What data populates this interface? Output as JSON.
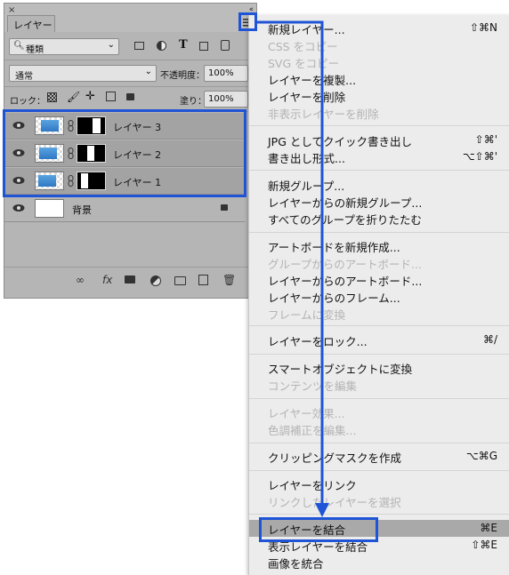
{
  "panel": {
    "close_glyph": "×",
    "collapse_glyph": "‹‹",
    "tab_label": "レイヤー",
    "filter_label": "種類",
    "blend_mode": "通常",
    "opacity_label": "不透明度：",
    "opacity_value": "100%",
    "lock_label": "ロック：",
    "fill_label": "塗り：",
    "fill_value": "100%",
    "layers": [
      {
        "name": "レイヤー 3"
      },
      {
        "name": "レイヤー 2"
      },
      {
        "name": "レイヤー 1"
      },
      {
        "name": "背景"
      }
    ],
    "fx_label": "fx"
  },
  "menu": {
    "items": [
      {
        "label": "新規レイヤー...",
        "shortcut": "⇧⌘N",
        "disabled": false
      },
      {
        "label": "CSS をコピー",
        "shortcut": "",
        "disabled": true
      },
      {
        "label": "SVG をコピー",
        "shortcut": "",
        "disabled": true
      },
      {
        "label": "レイヤーを複製...",
        "shortcut": "",
        "disabled": false
      },
      {
        "label": "レイヤーを削除",
        "shortcut": "",
        "disabled": false
      },
      {
        "label": "非表示レイヤーを削除",
        "shortcut": "",
        "disabled": true
      },
      {
        "label": "JPG としてクイック書き出し",
        "shortcut": "⇧⌘'",
        "disabled": false
      },
      {
        "label": "書き出し形式...",
        "shortcut": "⌥⇧⌘'",
        "disabled": false
      },
      {
        "label": "新規グループ...",
        "shortcut": "",
        "disabled": false
      },
      {
        "label": "レイヤーからの新規グループ...",
        "shortcut": "",
        "disabled": false
      },
      {
        "label": "すべてのグループを折りたたむ",
        "shortcut": "",
        "disabled": false
      },
      {
        "label": "アートボードを新規作成...",
        "shortcut": "",
        "disabled": false
      },
      {
        "label": "グループからのアートボード...",
        "shortcut": "",
        "disabled": true
      },
      {
        "label": "レイヤーからのアートボード...",
        "shortcut": "",
        "disabled": false
      },
      {
        "label": "レイヤーからのフレーム...",
        "shortcut": "",
        "disabled": false
      },
      {
        "label": "フレームに変換",
        "shortcut": "",
        "disabled": true
      },
      {
        "label": "レイヤーをロック...",
        "shortcut": "⌘/",
        "disabled": false
      },
      {
        "label": "スマートオブジェクトに変換",
        "shortcut": "",
        "disabled": false
      },
      {
        "label": "コンテンツを編集",
        "shortcut": "",
        "disabled": true
      },
      {
        "label": "レイヤー効果...",
        "shortcut": "",
        "disabled": true
      },
      {
        "label": "色調補正を編集...",
        "shortcut": "",
        "disabled": true
      },
      {
        "label": "クリッピングマスクを作成",
        "shortcut": "⌥⌘G",
        "disabled": false
      },
      {
        "label": "レイヤーをリンク",
        "shortcut": "",
        "disabled": false
      },
      {
        "label": "リンクしたレイヤーを選択",
        "shortcut": "",
        "disabled": true
      },
      {
        "label": "レイヤーを結合",
        "shortcut": "⌘E",
        "disabled": false
      },
      {
        "label": "表示レイヤーを結合",
        "shortcut": "⇧⌘E",
        "disabled": false
      },
      {
        "label": "画像を統合",
        "shortcut": "",
        "disabled": false
      }
    ]
  },
  "colors": {
    "annotation": "#1f54d6",
    "highlight": "#a9a9a9"
  }
}
